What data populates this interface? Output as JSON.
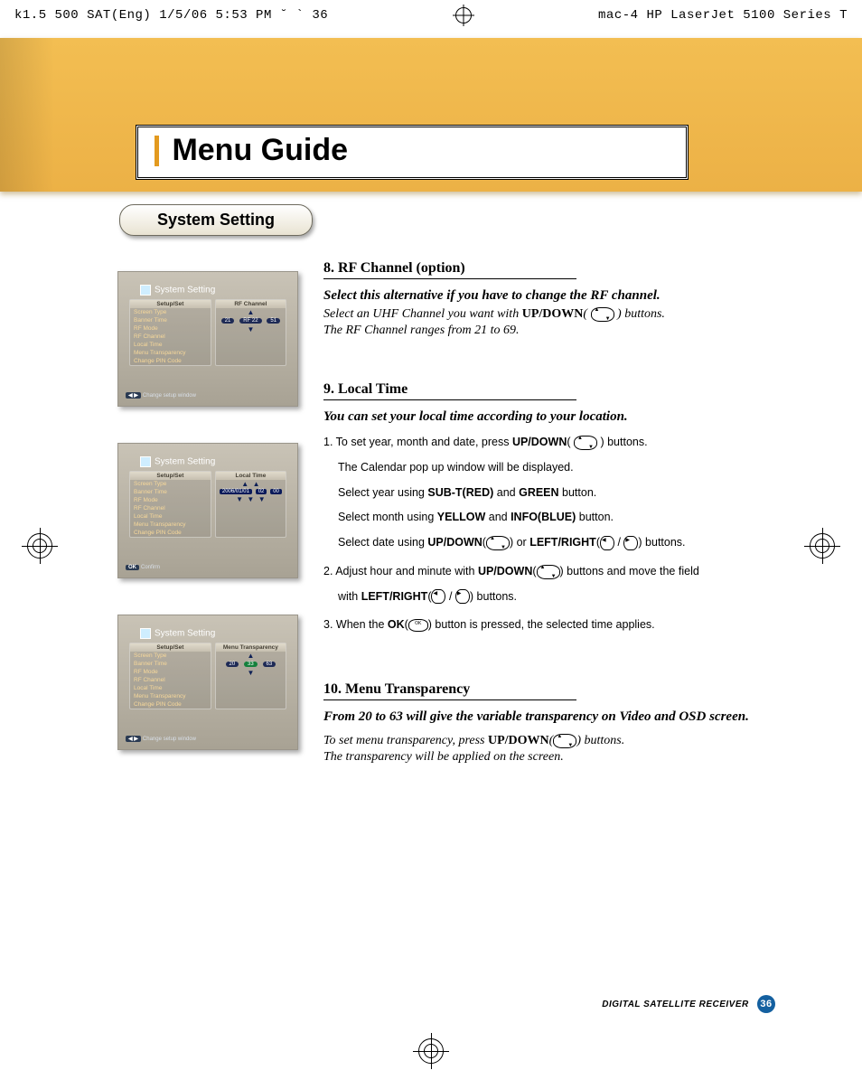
{
  "print_header": {
    "left": "k1.5 500 SAT(Eng)  1/5/06 5:53 PM  ˘  `  36",
    "right": "mac-4 HP LaserJet 5100 Series  T"
  },
  "title": "Menu Guide",
  "subtitle": "System Setting",
  "sections": {
    "s8": {
      "heading": "8. RF Channel (option)",
      "lead": "Select this alternative if you have to change the RF channel.",
      "p1_a": "Select an UHF Channel you want with ",
      "p1_b": "UP/DOWN",
      "p1_c": "(        ) buttons.",
      "p2": "The RF Channel ranges from 21 to 69."
    },
    "s9": {
      "heading": "9. Local Time",
      "lead": "You can set your local time according to your location.",
      "step1": {
        "l1a": "1. To set year, month and date, press ",
        "l1b": "UP/DOWN",
        "l1c": "(       ) buttons.",
        "l2": "The Calendar pop up window will be displayed.",
        "l3a": "Select year using ",
        "l3b": "SUB-T(RED)",
        "l3c": " and ",
        "l3d": "GREEN",
        "l3e": " button.",
        "l4a": "Select month using ",
        "l4b": "YELLOW",
        "l4c": " and ",
        "l4d": "INFO(BLUE)",
        "l4e": " button.",
        "l5a": "Select date using ",
        "l5b": "UP/DOWN",
        "l5c": "(      ) or ",
        "l5d": "LEFT/RIGHT",
        "l5e": "(   /   ) buttons."
      },
      "step2": {
        "l1a": "2. Adjust hour and minute with ",
        "l1b": "UP/DOWN",
        "l1c": "(      ) buttons and move the field",
        "l2a": "with ",
        "l2b": "LEFT/RIGHT",
        "l2c": "(   /   ) buttons."
      },
      "step3": {
        "a": "3. When the ",
        "b": "OK",
        "c": "(    ) button is pressed, the selected time applies."
      }
    },
    "s10": {
      "heading": "10. Menu Transparency",
      "lead": "From 20 to 63 will give the variable transparency on Video and OSD screen.",
      "p1a": "To set menu transparency, press ",
      "p1b": "UP/DOWN",
      "p1c": "(      ) buttons.",
      "p2": "The transparency will be applied on the screen."
    }
  },
  "screenshots": {
    "common": {
      "title": "System Setting",
      "left_header": "Setup/Set",
      "menu": [
        "Screen Type",
        "Banner Time",
        "RF Mode",
        "RF Channel",
        "Local Time",
        "Menu Transparency",
        "Change PIN Code"
      ]
    },
    "a": {
      "right_header": "RF Channel",
      "values": [
        "21",
        "RF 22",
        "51"
      ],
      "footer_key": "◀ ▶",
      "footer_text": "Change setup window"
    },
    "b": {
      "right_header": "Local Time",
      "date": "2006/01/01",
      "hh": "02",
      "mm": "00",
      "footer_key": "OK",
      "footer_text": "Confirm"
    },
    "c": {
      "right_header": "Menu Transparency",
      "values": [
        "20",
        "33",
        "63"
      ],
      "footer_key": "◀ ▶",
      "footer_text": "Change setup window"
    }
  },
  "footer": {
    "label": "DIGITAL SATELLITE RECEIVER",
    "page": "36"
  }
}
